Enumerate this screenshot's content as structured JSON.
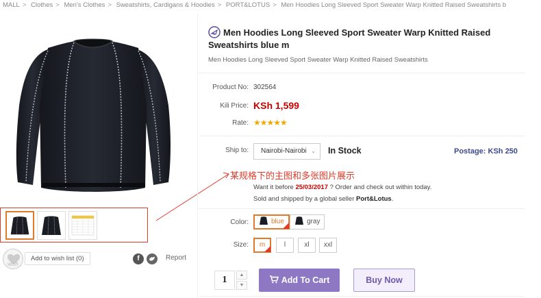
{
  "breadcrumb": [
    "MALL",
    "Clothes",
    "Men's Clothes",
    "Sweatshirts, Cardigans & Hoodies",
    "PORT&LOTUS",
    "Men Hoodies Long Sleeved Sport Sweater Warp Knitted Raised Sweatshirts b"
  ],
  "breadcrumb_sep": ">",
  "product": {
    "title": "Men Hoodies Long Sleeved Sport Sweater Warp Knitted Raised Sweatshirts blue m",
    "subtitle": "Men Hoodies Long Sleeved Sport Sweater Warp Knitted Raised Sweatshirts",
    "product_no_label": "Product No:",
    "product_no": "302564",
    "price_label": "Kili Price:",
    "price": "KSh 1,599",
    "rate_label": "Rate:",
    "rating_stars": 5,
    "stars_text": "★★★★★"
  },
  "shipping": {
    "ship_to_label": "Ship to:",
    "ship_to_value": "Nairobi-Nairobi",
    "caret": "⌄",
    "stock": "In Stock",
    "postage": "Postage: KSh 250"
  },
  "annotation": {
    "text": "某规格下的主图和多张图片展示"
  },
  "order": {
    "want_prefix": "Want it before",
    "date": "25/03/2017",
    "want_suffix": "? Order and check out within today.",
    "sold_prefix": "Sold and shipped by a global seller",
    "seller": "Port&Lotus",
    "sold_suffix": "."
  },
  "options": {
    "color_label": "Color:",
    "colors": [
      "blue",
      "gray"
    ],
    "selected_color": "blue",
    "size_label": "Size:",
    "sizes": [
      "m",
      "l",
      "xl",
      "xxl"
    ],
    "selected_size": "m"
  },
  "wishlist": {
    "icon_label": "wish",
    "button": "Add to wish list (0)"
  },
  "social": {
    "facebook": "f",
    "report": "Report"
  },
  "cart": {
    "quantity": "1",
    "add_to_cart": "Add To Cart",
    "buy_now": "Buy Now",
    "cart_icon": "🛒"
  },
  "colors": {
    "price_red": "#cc0000",
    "accent_purple": "#8e78c4",
    "postage_blue": "#3c4a8c",
    "annotation_red": "#e03a2a",
    "selected_orange": "#e07a2a"
  }
}
